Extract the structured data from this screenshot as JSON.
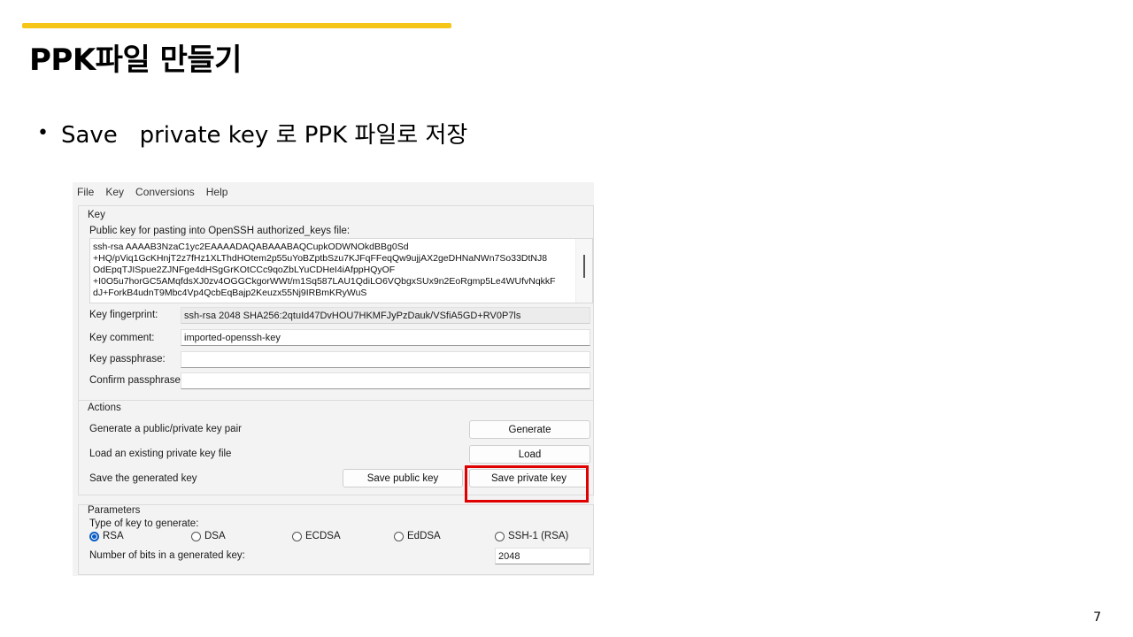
{
  "slide": {
    "title": "PPK파일 만들기",
    "bullet_dot": "•",
    "bullet_text": "Save   private key 로 PPK 파일로 저장",
    "page_number": "7",
    "accent_color": "#f5c518"
  },
  "menu": [
    "File",
    "Key",
    "Conversions",
    "Help"
  ],
  "key_group": {
    "label": "Key",
    "pubkey_label": "Public key for pasting into OpenSSH authorized_keys file:",
    "pubkey_lines": [
      "ssh-rsa AAAAB3NzaC1yc2EAAAADAQABAAABAQCupkODWNOkdBBg0Sd",
      "+HQ/pViq1GcKHnjT2z7fHz1XLThdHOtem2p55uYoBZptbSzu7KJFqFFeqQw9ujjAX2geDHNaNWn7So33DtNJ8",
      "OdEpqTJISpue2ZJNFge4dHSgGrKOtCCc9qoZbLYuCDHeI4iAfppHQyOF",
      "+I0O5u7horGC5AMqfdsXJ0zv4OGGCkgorWWt/m1Sq587LAU1QdiLO6VQbgxSUx9n2EoRgmp5Le4WUfvNqkkF",
      "dJ+ForkB4udnT9Mbc4Vp4QcbEqBajp2Keuzx55Nj9IRBmKRyWuS"
    ],
    "fingerprint_label": "Key fingerprint:",
    "fingerprint_value": "ssh-rsa 2048 SHA256:2qtuId47DvHOU7HKMFJyPzDauk/VSfiA5GD+RV0P7ls",
    "comment_label": "Key comment:",
    "comment_value": "imported-openssh-key",
    "passphrase_label": "Key passphrase:",
    "passphrase_value": "",
    "confirm_label": "Confirm passphrase:",
    "confirm_value": ""
  },
  "actions": {
    "label": "Actions",
    "generate_text": "Generate a public/private key pair",
    "generate_button": "Generate",
    "load_text": "Load an existing private key file",
    "load_button": "Load",
    "save_text": "Save the generated key",
    "save_public_button": "Save public key",
    "save_private_button": "Save private key",
    "highlight_color": "#e00000"
  },
  "parameters": {
    "label": "Parameters",
    "type_label": "Type of key to generate:",
    "key_types": [
      "RSA",
      "DSA",
      "ECDSA",
      "EdDSA",
      "SSH-1 (RSA)"
    ],
    "selected_type": "RSA",
    "bits_label": "Number of bits in a generated key:",
    "bits_value": "2048"
  }
}
